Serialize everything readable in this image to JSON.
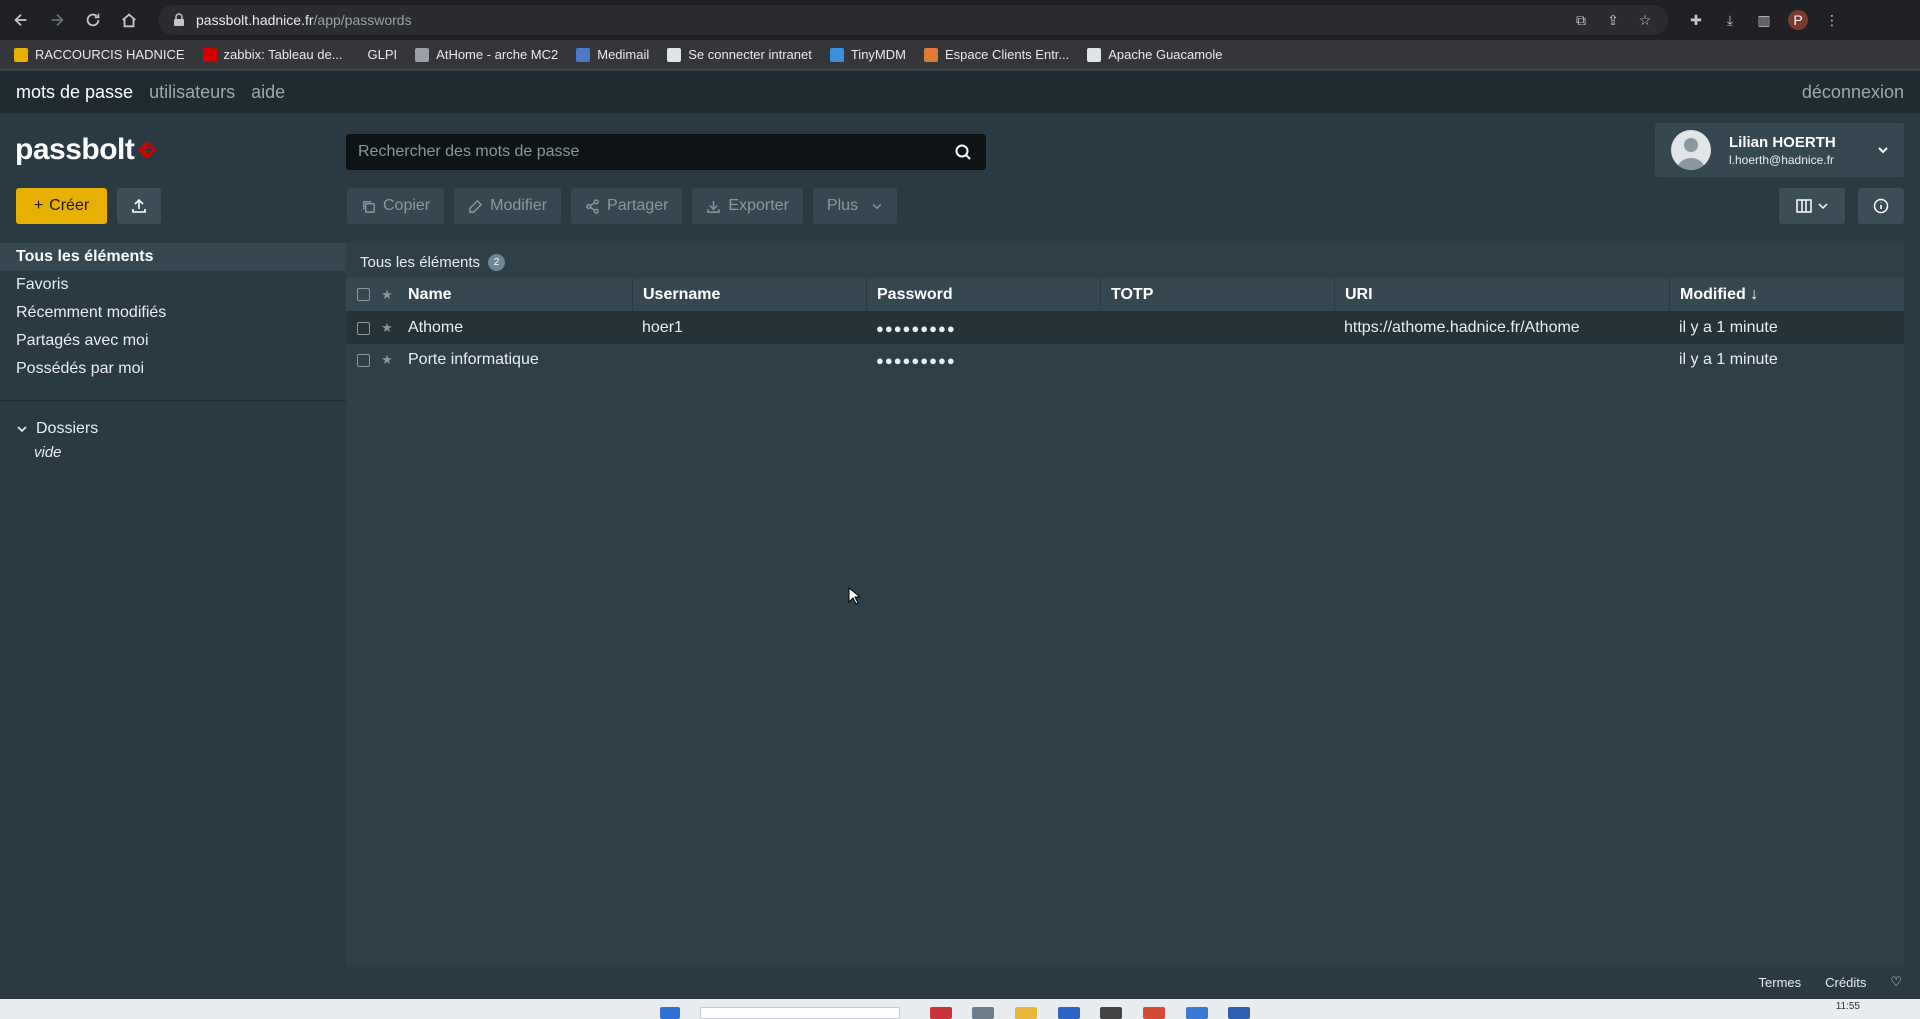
{
  "browser": {
    "url_host": "passbolt.hadnice.fr",
    "url_path": "/app/passwords",
    "profile_initial": "P",
    "bookmarks": [
      {
        "label": "RACCOURCIS HADNICE",
        "icon": "folder-icon",
        "color": "#e5b000"
      },
      {
        "label": "zabbix: Tableau de...",
        "icon": "zabbix-icon",
        "color": "#d40000"
      },
      {
        "label": "GLPI",
        "icon": "glpi-icon",
        "color": ""
      },
      {
        "label": "AtHome - arche MC2",
        "icon": "globe-icon",
        "color": "#9aa0a6"
      },
      {
        "label": "Medimail",
        "icon": "medimail-icon",
        "color": "#4a79c5"
      },
      {
        "label": "Se connecter intranet",
        "icon": "intranet-icon",
        "color": "#dfe3e6"
      },
      {
        "label": "TinyMDM",
        "icon": "tinymdm-icon",
        "color": "#3b8ee0"
      },
      {
        "label": "Espace Clients Entr...",
        "icon": "espace-icon",
        "color": "#e07a3b"
      },
      {
        "label": "Apache Guacamole",
        "icon": "guacamole-icon",
        "color": "#dfe3e6"
      }
    ]
  },
  "nav": {
    "passwords": "mots de passe",
    "users": "utilisateurs",
    "help": "aide",
    "logout": "déconnexion"
  },
  "header": {
    "logo": "passbolt",
    "search_placeholder": "Rechercher des mots de passe",
    "user_name": "Lilian HOERTH",
    "user_email": "l.hoerth@hadnice.fr"
  },
  "toolbar": {
    "create": "Créer",
    "copy": "Copier",
    "edit": "Modifier",
    "share": "Partager",
    "export": "Exporter",
    "more": "Plus"
  },
  "sidebar": {
    "filters": [
      {
        "label": "Tous les éléments",
        "active": true
      },
      {
        "label": "Favoris",
        "active": false
      },
      {
        "label": "Récemment modifiés",
        "active": false
      },
      {
        "label": "Partagés avec moi",
        "active": false
      },
      {
        "label": "Possédés par moi",
        "active": false
      }
    ],
    "folders_title": "Dossiers",
    "folders_empty": "vide"
  },
  "main": {
    "breadcrumb": "Tous les éléments",
    "count": "2",
    "columns": {
      "name": "Name",
      "username": "Username",
      "password": "Password",
      "totp": "TOTP",
      "uri": "URI",
      "modified": "Modified ↓"
    },
    "rows": [
      {
        "name": "Athome",
        "username": "hoer1",
        "password": "●●●●●●●●●",
        "totp": "",
        "uri": "https://athome.hadnice.fr/Athome",
        "modified": "il y a 1 minute"
      },
      {
        "name": "Porte informatique",
        "username": "",
        "password": "●●●●●●●●●",
        "totp": "",
        "uri": "",
        "modified": "il y a 1 minute"
      }
    ]
  },
  "footer": {
    "terms": "Termes",
    "credits": "Crédits"
  },
  "taskbar": {
    "clock": "11:55"
  },
  "colors": {
    "accent": "#e5b000",
    "logo_mark": "#d40000"
  }
}
